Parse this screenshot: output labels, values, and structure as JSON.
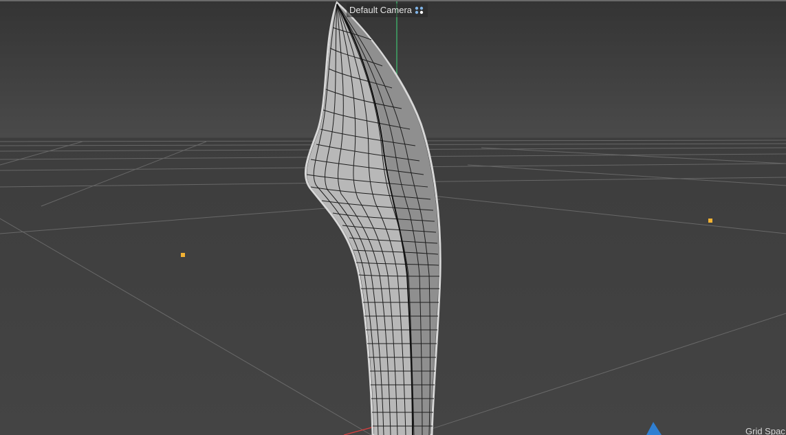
{
  "viewport": {
    "camera_label": "Default Camera",
    "camera_icon": "camera-orbit-icon",
    "grid_label": "Grid Spac",
    "colors": {
      "background": "#3a3a3a",
      "grid_line": "#8a8a8a",
      "y_axis": "#3fb06a",
      "x_axis": "#d94040",
      "z_axis": "#3a7fd0",
      "light_marker": "#f2b233",
      "mesh_face": "#b5b5b5",
      "mesh_wire": "#1a1a1a"
    }
  }
}
